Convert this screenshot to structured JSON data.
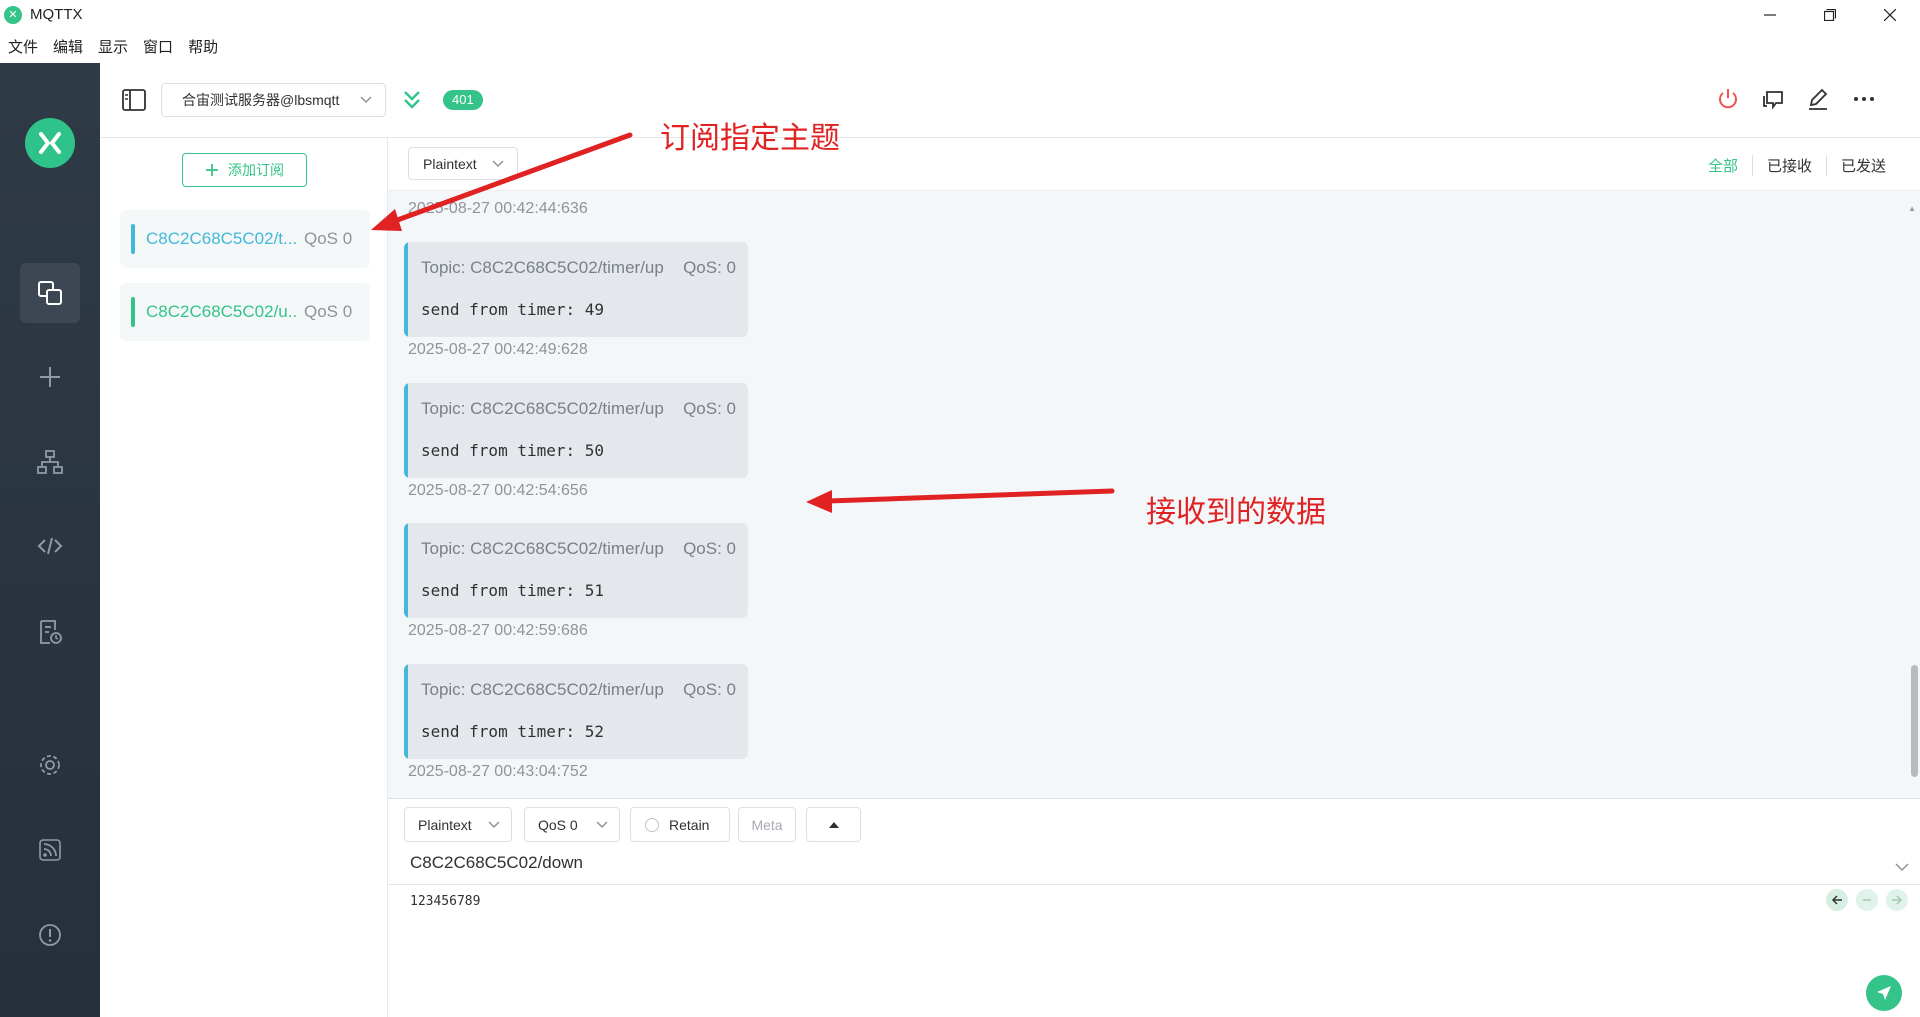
{
  "window": {
    "title": "MQTTX",
    "controls": [
      "minimize",
      "restore",
      "close"
    ]
  },
  "menu": [
    "文件",
    "编辑",
    "显示",
    "窗口",
    "帮助"
  ],
  "toolbar": {
    "connection_name": "合宙测试服务器@lbsmqtt",
    "message_count": "401"
  },
  "subscriptions": {
    "add_label": "添加订阅",
    "items": [
      {
        "topic": "C8C2C68C5C02/t...",
        "qos": "QoS 0",
        "color": "#43b8d9"
      },
      {
        "topic": "C8C2C68C5C02/u...",
        "qos": "QoS 0",
        "color": "#34c388"
      }
    ]
  },
  "messages": {
    "format": "Plaintext",
    "filters": [
      "全部",
      "已接收",
      "已发送"
    ],
    "first_timestamp": "2025-08-27 00:42:44:636",
    "items": [
      {
        "topic": "Topic: C8C2C68C5C02/timer/up",
        "qos": "QoS: 0",
        "payload": "send from timer: 49",
        "timestamp": "2025-08-27 00:42:49:628"
      },
      {
        "topic": "Topic: C8C2C68C5C02/timer/up",
        "qos": "QoS: 0",
        "payload": "send from timer: 50",
        "timestamp": "2025-08-27 00:42:54:656"
      },
      {
        "topic": "Topic: C8C2C68C5C02/timer/up",
        "qos": "QoS: 0",
        "payload": "send from timer: 51",
        "timestamp": "2025-08-27 00:42:59:686"
      },
      {
        "topic": "Topic: C8C2C68C5C02/timer/up",
        "qos": "QoS: 0",
        "payload": "send from timer: 52",
        "timestamp": "2025-08-27 00:43:04:752"
      }
    ]
  },
  "annotations": {
    "subscribe": "订阅指定主题",
    "received": "接收到的数据"
  },
  "publish": {
    "format": "Plaintext",
    "qos": "QoS 0",
    "retain": "Retain",
    "meta": "Meta",
    "topic": "C8C2C68C5C02/down",
    "payload": "123456789"
  },
  "colors": {
    "accent": "#34c388",
    "topic_bar": "#43b8d9",
    "annotation": "#e02222",
    "nav_bg": "#2e3a46"
  },
  "icons": [
    "logo-icon",
    "connections-icon",
    "plus-icon",
    "topology-icon",
    "script-icon",
    "log-icon",
    "settings-icon",
    "feed-icon",
    "about-icon",
    "disconnect-icon",
    "new-window-icon",
    "edit-icon",
    "more-icon",
    "send-icon"
  ]
}
